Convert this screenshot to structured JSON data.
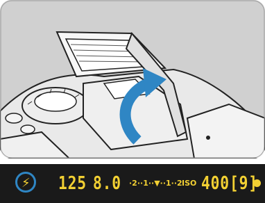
{
  "illustration": {
    "subject": "camera-top-with-built-in-flash-raised",
    "arrow_color": "#2f86c4"
  },
  "viewfinder": {
    "background": "#1a1a1a",
    "display_color": "#f2d033",
    "shutter_speed": "125",
    "aperture": "8.0",
    "exposure_scale": "·2··1··▼··1··2",
    "iso_label": "ISO",
    "iso_value": "400",
    "shots_remaining": "[9]",
    "flash_icon": "flash-ready-icon"
  }
}
